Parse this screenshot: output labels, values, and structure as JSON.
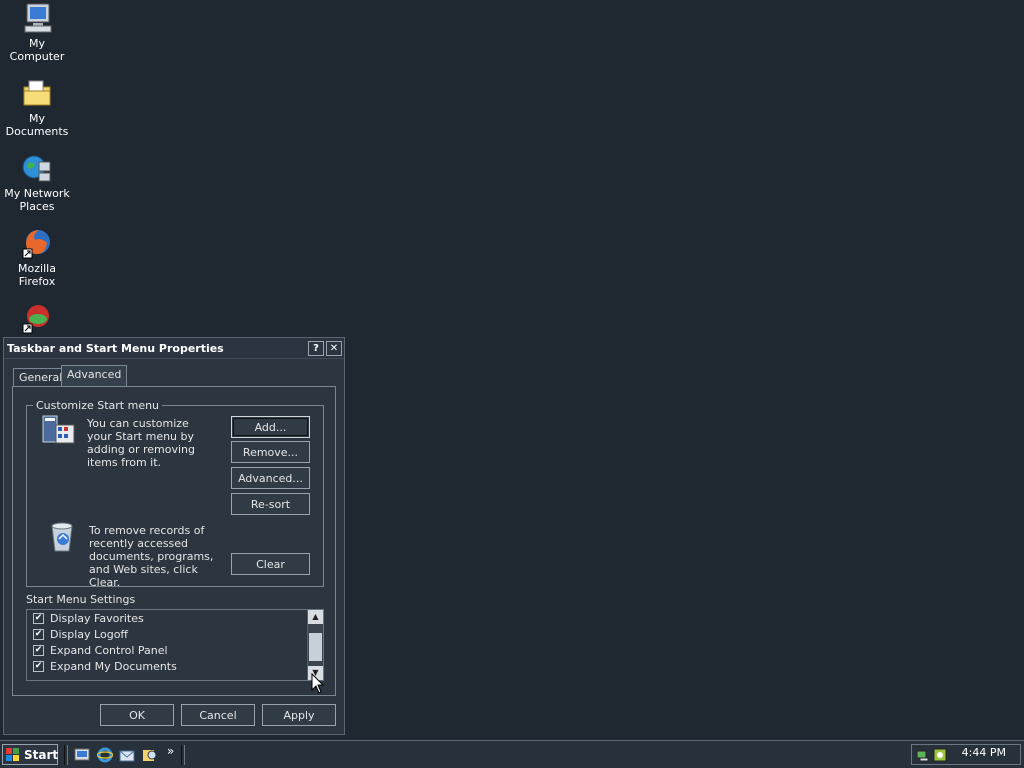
{
  "desktop": {
    "icons": [
      {
        "label": "My Computer"
      },
      {
        "label": "My Documents"
      },
      {
        "label": "My Network Places"
      },
      {
        "label": "Mozilla Firefox"
      }
    ]
  },
  "dialog": {
    "title": "Taskbar and Start Menu Properties",
    "help_glyph": "?",
    "close_glyph": "✕",
    "tabs": [
      {
        "label": "General"
      },
      {
        "label": "Advanced"
      }
    ],
    "customize_group": {
      "title": "Customize Start menu",
      "description": "You can customize your Start menu by adding or removing items from it.",
      "buttons": {
        "add": "Add...",
        "remove": "Remove...",
        "advanced": "Advanced...",
        "resort": "Re-sort",
        "clear": "Clear"
      },
      "clear_description": "To remove records of recently accessed documents, programs, and Web sites, click Clear."
    },
    "settings": {
      "label": "Start Menu Settings",
      "items": [
        {
          "label": "Display Favorites",
          "checked": true
        },
        {
          "label": "Display Logoff",
          "checked": true
        },
        {
          "label": "Expand Control Panel",
          "checked": true
        },
        {
          "label": "Expand My Documents",
          "checked": true
        }
      ]
    },
    "footer": {
      "ok": "OK",
      "cancel": "Cancel",
      "apply": "Apply"
    }
  },
  "taskbar": {
    "start_label": "Start",
    "chevron": "»",
    "clock": "4:44 PM"
  },
  "colors": {
    "desktop_bg": "#1f2731",
    "dialog_bg": "#2d3640",
    "accent": "#ffffff"
  }
}
